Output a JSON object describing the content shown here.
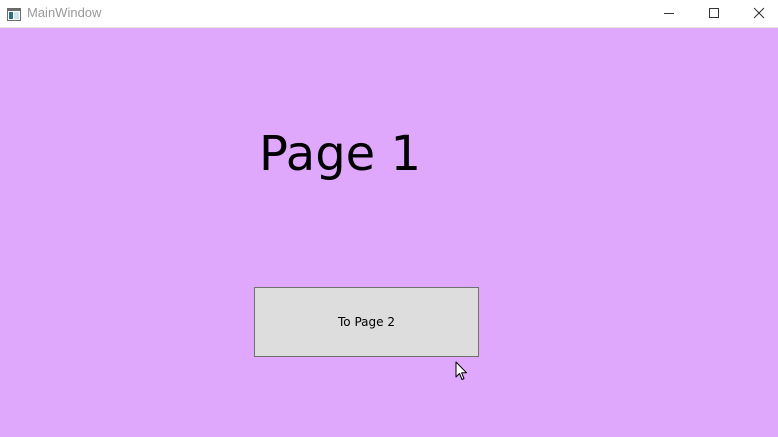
{
  "window": {
    "title": "MainWindow",
    "icon": "app-window-icon",
    "controls": {
      "minimize_icon": "minimize-icon",
      "maximize_icon": "maximize-icon",
      "close_icon": "close-icon"
    }
  },
  "page": {
    "heading": "Page 1",
    "background": "#dfa8fd",
    "button_label": "To Page 2",
    "button_background": "#dddddd"
  },
  "cursor": {
    "icon": "arrow-cursor-icon"
  }
}
